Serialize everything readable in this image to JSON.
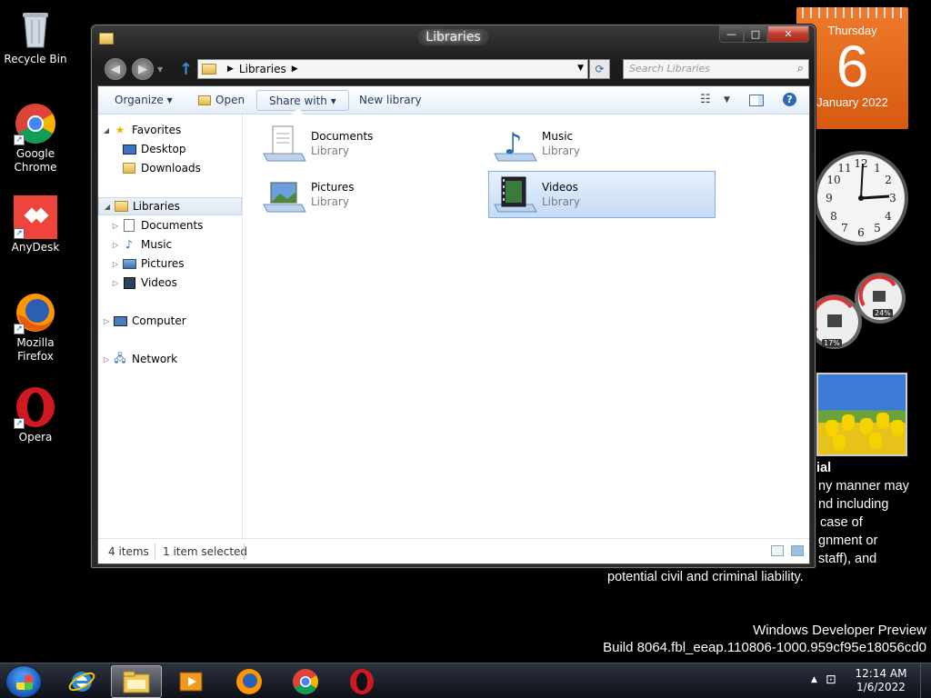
{
  "desktop": {
    "icons": [
      {
        "label": "Recycle Bin"
      },
      {
        "label": "Google Chrome"
      },
      {
        "label": "AnyDesk"
      },
      {
        "label": "Mozilla Firefox"
      },
      {
        "label": "Opera"
      }
    ]
  },
  "gadgets": {
    "calendar": {
      "weekday": "Thursday",
      "day": "6",
      "month_year": "January 2022"
    },
    "clock": {
      "time": "12:14"
    },
    "cpu_meter": {
      "cpu": "17%",
      "memory": "24%"
    }
  },
  "legal_text": {
    "title": "ial",
    "lines": [
      "ny manner may",
      "nd including",
      "case of",
      "gnment or",
      "staff), and",
      "potential civil and criminal liability."
    ]
  },
  "watermark": {
    "line1": "Windows Developer Preview",
    "line2": "Build 8064.fbl_eeap.110806-1000.959cf95e18056cd0"
  },
  "window": {
    "title": "Libraries",
    "caption": {
      "minimize": "—",
      "maximize": "□",
      "close": "✕"
    },
    "address": {
      "crumb": "Libraries"
    },
    "search_placeholder": "Search Libraries",
    "toolbar": {
      "organize": "Organize ▾",
      "open": "Open",
      "share_with": "Share with ▾",
      "new_library": "New library",
      "help": "?"
    },
    "nav": {
      "favorites": "Favorites",
      "desktop": "Desktop",
      "downloads": "Downloads",
      "libraries": "Libraries",
      "documents": "Documents",
      "music": "Music",
      "pictures": "Pictures",
      "videos": "Videos",
      "computer": "Computer",
      "network": "Network"
    },
    "libraries": [
      {
        "name": "Documents",
        "type": "Library"
      },
      {
        "name": "Music",
        "type": "Library"
      },
      {
        "name": "Pictures",
        "type": "Library"
      },
      {
        "name": "Videos",
        "type": "Library"
      }
    ],
    "status": {
      "count": "4 items",
      "selected": "1 item selected"
    }
  },
  "taskbar": {
    "clock": {
      "time": "12:14 AM",
      "date": "1/6/2022"
    }
  }
}
